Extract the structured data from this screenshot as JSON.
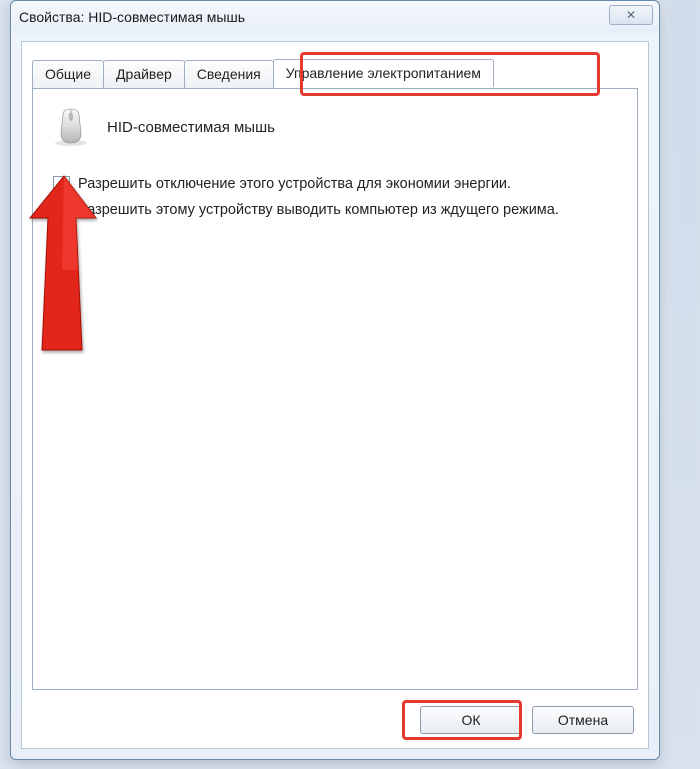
{
  "window": {
    "title": "Свойства: HID-совместимая мышь",
    "close_label": "✕"
  },
  "tabs": {
    "general": "Общие",
    "driver": "Драйвер",
    "details": "Сведения",
    "power": "Управление электропитанием"
  },
  "panel": {
    "device_name": "HID-совместимая мышь",
    "allow_turnoff": "Разрешить отключение этого устройства для экономии энергии.",
    "allow_wake": "Разрешить этому устройству выводить компьютер из ждущего режима."
  },
  "buttons": {
    "ok": "ОК",
    "cancel": "Отмена"
  }
}
